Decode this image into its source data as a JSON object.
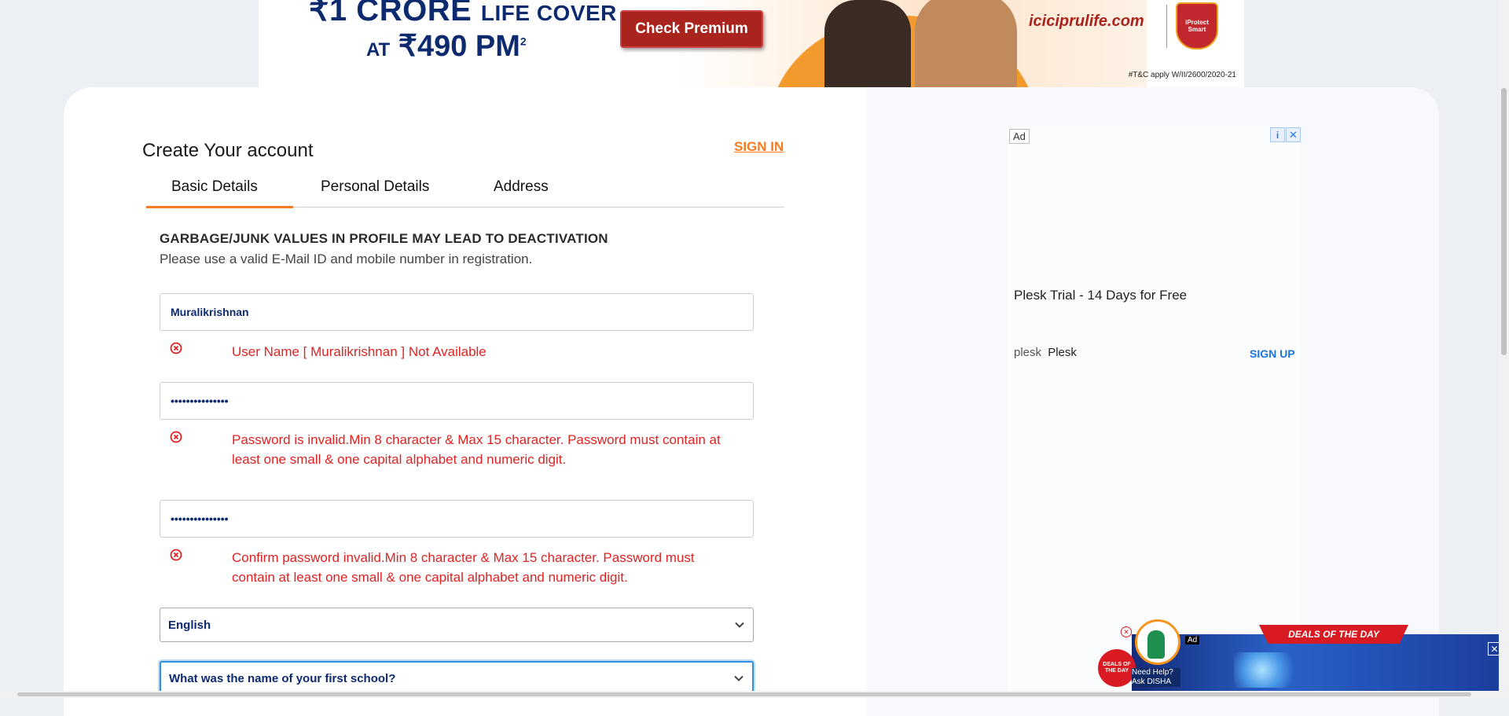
{
  "banner": {
    "line1_big": "₹1 CRORE",
    "line1_small": "LIFE COVER",
    "line2_small": "AT",
    "line2_big": "₹490 PM",
    "line2_sup": "2",
    "cta_label": "Check Premium",
    "site": "iciciprulife.com",
    "shield_text": "iProtect Smart",
    "tnc": "#T&C apply W/II/2600/2020-21"
  },
  "form": {
    "title": "Create Your account",
    "signin_label": "SIGN IN",
    "tabs": [
      {
        "label": "Basic Details",
        "active": true
      },
      {
        "label": "Personal Details",
        "active": false
      },
      {
        "label": "Address",
        "active": false
      }
    ],
    "warning_title": "GARBAGE/JUNK VALUES IN PROFILE MAY LEAD TO DEACTIVATION",
    "warning_sub": "Please use a valid E-Mail ID and mobile number in registration.",
    "username_value": "Muralikrishnan",
    "username_error": "User Name [ Muralikrishnan ] Not Available",
    "password_value": "•••••••••••••••",
    "password_error": "Password is invalid.Min 8 character & Max 15 character. Password must contain at least one small & one capital alphabet and numeric digit.",
    "confirm_value": "•••••••••••••••",
    "confirm_error": "Confirm password invalid.Min 8 character & Max 15 character. Password must contain at least one small & one capital alphabet and numeric digit.",
    "language_value": "English",
    "security_question_value": "What was the name of your first school?"
  },
  "side_ad": {
    "badge": "Ad",
    "headline": "Plesk Trial - 14 Days for Free",
    "brand_mark": "plesk",
    "brand_name": "Plesk",
    "cta": "SIGN UP"
  },
  "widgets": {
    "deals_banner": "DEALS OF THE DAY",
    "ad_badge": "Ad",
    "disha_line1": "Need Help?",
    "disha_line2": "Ask DISHA",
    "deals_day_text": "DEALS OF THE DAY"
  },
  "colors": {
    "accent": "#f47b20",
    "error": "#e12222",
    "field_text": "#0e2a6f"
  }
}
